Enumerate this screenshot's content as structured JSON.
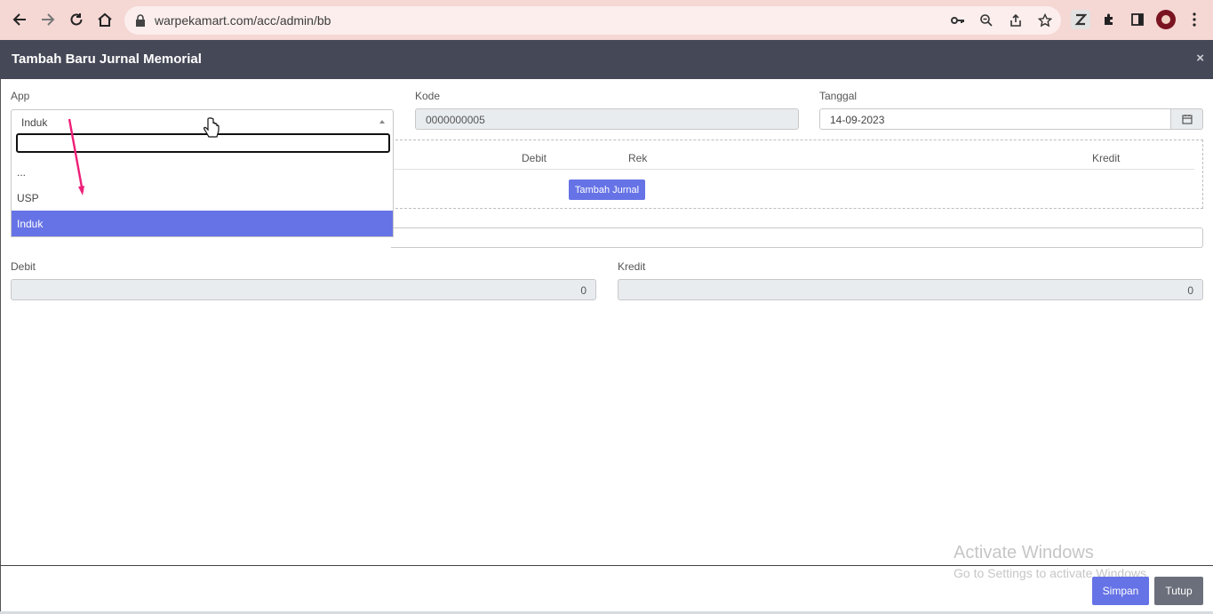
{
  "browser": {
    "url": "warpekamart.com/acc/admin/bb"
  },
  "modal": {
    "title": "Tambah Baru Jurnal Memorial",
    "close": "×"
  },
  "form": {
    "app_label": "App",
    "app_value": "Induk",
    "kode_label": "Kode",
    "kode_value": "0000000005",
    "tanggal_label": "Tanggal",
    "tanggal_value": "14-09-2023",
    "debit_label": "Debit",
    "debit_value": "0",
    "kredit_label": "Kredit",
    "kredit_value": "0",
    "note_placeholder": "..."
  },
  "journal_table": {
    "headers": [
      "Debit",
      "Rek",
      "Kredit"
    ],
    "add_button": "Tambah Jurnal"
  },
  "dropdown": {
    "options": [
      "...",
      "USP",
      "Induk"
    ],
    "selected": "Induk"
  },
  "footer": {
    "save": "Simpan",
    "close": "Tutup"
  },
  "watermark": {
    "line1": "Activate Windows",
    "line2": "Go to Settings to activate Windows."
  }
}
